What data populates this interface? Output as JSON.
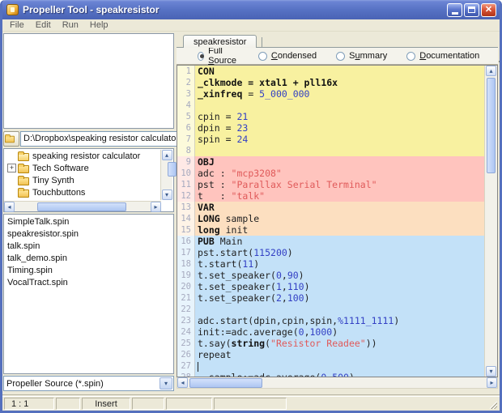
{
  "window": {
    "title": "Propeller Tool - speakresistor"
  },
  "icons": {
    "close": "✕",
    "dropdown": "▾",
    "scroll_up": "▴",
    "scroll_down": "▾",
    "scroll_left": "◂",
    "scroll_right": "▸",
    "expand_plus": "+",
    "folder": "folder-icon",
    "folder_open": "folder-open-icon",
    "top_folder": "top-folder-icon"
  },
  "menu": {
    "items": [
      "File",
      "Edit",
      "Run",
      "Help"
    ]
  },
  "tab": {
    "label": "speakresistor"
  },
  "view_modes": [
    {
      "pre": "Full ",
      "u": "S",
      "post": "ource",
      "selected": true
    },
    {
      "pre": "",
      "u": "C",
      "post": "ondensed",
      "selected": false
    },
    {
      "pre": "S",
      "u": "u",
      "post": "mmary",
      "selected": false
    },
    {
      "pre": "",
      "u": "D",
      "post": "ocumentation",
      "selected": false
    }
  ],
  "explorer": {
    "path": "D:\\Dropbox\\speaking resistor calculator",
    "tree": [
      {
        "label": "speaking resistor calculator",
        "icon": "folder-open",
        "expand": ""
      },
      {
        "label": "Tech Software",
        "icon": "folder",
        "expand": "+"
      },
      {
        "label": "Tiny Synth",
        "icon": "folder",
        "expand": ""
      },
      {
        "label": "Touchbuttons",
        "icon": "folder",
        "expand": ""
      }
    ],
    "files": [
      "SimpleTalk.spin",
      "speakresistor.spin",
      "talk.spin",
      "talk_demo.spin",
      "Timing.spin",
      "VocalTract.spin"
    ],
    "filter": "Propeller Source (*.spin)"
  },
  "editor": {
    "colors": {
      "con": "#F8F1A0",
      "obj": "#FFC4BE",
      "var": "#FCDFC0",
      "pub": "#C3E1F8",
      "number": "#3340C4",
      "string": "#E05A5A"
    },
    "lines": [
      {
        "n": 1,
        "block": "con",
        "seg": [
          [
            "k",
            "CON"
          ]
        ]
      },
      {
        "n": 2,
        "block": "con",
        "seg": [
          [
            "k",
            "_clkmode = xtal1 + pll16x"
          ]
        ]
      },
      {
        "n": 3,
        "block": "con",
        "seg": [
          [
            "k",
            "_xinfreq"
          ],
          [
            "t",
            " = "
          ],
          [
            "n",
            "5_000_000"
          ]
        ]
      },
      {
        "n": 4,
        "block": "con",
        "seg": []
      },
      {
        "n": 5,
        "block": "con",
        "seg": [
          [
            "t",
            "cpin = "
          ],
          [
            "n",
            "21"
          ]
        ]
      },
      {
        "n": 6,
        "block": "con",
        "seg": [
          [
            "t",
            "dpin = "
          ],
          [
            "n",
            "23"
          ]
        ]
      },
      {
        "n": 7,
        "block": "con",
        "seg": [
          [
            "t",
            "spin = "
          ],
          [
            "n",
            "24"
          ]
        ]
      },
      {
        "n": 8,
        "block": "con",
        "seg": []
      },
      {
        "n": 9,
        "block": "obj",
        "seg": [
          [
            "k",
            "OBJ"
          ]
        ]
      },
      {
        "n": 10,
        "block": "obj",
        "seg": [
          [
            "t",
            "adc : "
          ],
          [
            "s",
            "\"mcp3208\""
          ]
        ]
      },
      {
        "n": 11,
        "block": "obj",
        "seg": [
          [
            "t",
            "pst : "
          ],
          [
            "s",
            "\"Parallax Serial Terminal\""
          ]
        ]
      },
      {
        "n": 12,
        "block": "obj",
        "seg": [
          [
            "t",
            "t   : "
          ],
          [
            "s",
            "\"talk\""
          ]
        ]
      },
      {
        "n": 13,
        "block": "var",
        "seg": [
          [
            "k",
            "VAR"
          ]
        ]
      },
      {
        "n": 14,
        "block": "var",
        "seg": [
          [
            "k",
            "LONG"
          ],
          [
            "t",
            " sample"
          ]
        ]
      },
      {
        "n": 15,
        "block": "var",
        "seg": [
          [
            "k",
            "long"
          ],
          [
            "t",
            " init"
          ]
        ]
      },
      {
        "n": 16,
        "block": "pub",
        "seg": [
          [
            "k",
            "PUB"
          ],
          [
            "t",
            " Main"
          ]
        ]
      },
      {
        "n": 17,
        "block": "pub",
        "seg": [
          [
            "t",
            "pst.start("
          ],
          [
            "n",
            "115200"
          ],
          [
            "t",
            ")"
          ]
        ]
      },
      {
        "n": 18,
        "block": "pub",
        "seg": [
          [
            "t",
            "t.start("
          ],
          [
            "n",
            "11"
          ],
          [
            "t",
            ")"
          ]
        ]
      },
      {
        "n": 19,
        "block": "pub",
        "seg": [
          [
            "t",
            "t.set_speaker("
          ],
          [
            "n",
            "0"
          ],
          [
            "t",
            ","
          ],
          [
            "n",
            "90"
          ],
          [
            "t",
            ")"
          ]
        ]
      },
      {
        "n": 20,
        "block": "pub",
        "seg": [
          [
            "t",
            "t.set_speaker("
          ],
          [
            "n",
            "1"
          ],
          [
            "t",
            ","
          ],
          [
            "n",
            "110"
          ],
          [
            "t",
            ")"
          ]
        ]
      },
      {
        "n": 21,
        "block": "pub",
        "seg": [
          [
            "t",
            "t.set_speaker("
          ],
          [
            "n",
            "2"
          ],
          [
            "t",
            ","
          ],
          [
            "n",
            "100"
          ],
          [
            "t",
            ")"
          ]
        ]
      },
      {
        "n": 22,
        "block": "pub",
        "seg": []
      },
      {
        "n": 23,
        "block": "pub",
        "seg": [
          [
            "t",
            "adc.start(dpin,cpin,spin,"
          ],
          [
            "n",
            "%1111_1111"
          ],
          [
            "t",
            ")"
          ]
        ]
      },
      {
        "n": 24,
        "block": "pub",
        "seg": [
          [
            "t",
            "init:=adc.average("
          ],
          [
            "n",
            "0"
          ],
          [
            "t",
            ","
          ],
          [
            "n",
            "1000"
          ],
          [
            "t",
            ")"
          ]
        ]
      },
      {
        "n": 25,
        "block": "pub",
        "seg": [
          [
            "t",
            "t.say("
          ],
          [
            "k",
            "string"
          ],
          [
            "t",
            "("
          ],
          [
            "s",
            "\"Resistor Readee\""
          ],
          [
            "t",
            "))"
          ]
        ]
      },
      {
        "n": 26,
        "block": "pub",
        "seg": [
          [
            "t",
            "repeat"
          ]
        ],
        "caret": false
      },
      {
        "n": 27,
        "block": "pub",
        "seg": [],
        "caret": true
      },
      {
        "n": 28,
        "block": "pub",
        "seg": [
          [
            "t",
            "  sample:=adc.average("
          ],
          [
            "n",
            "0"
          ],
          [
            "t",
            ","
          ],
          [
            "n",
            "500"
          ],
          [
            "t",
            ")"
          ]
        ]
      }
    ]
  },
  "status": {
    "panels": [
      "1 : 1",
      "",
      "Insert",
      "",
      "",
      ""
    ]
  }
}
